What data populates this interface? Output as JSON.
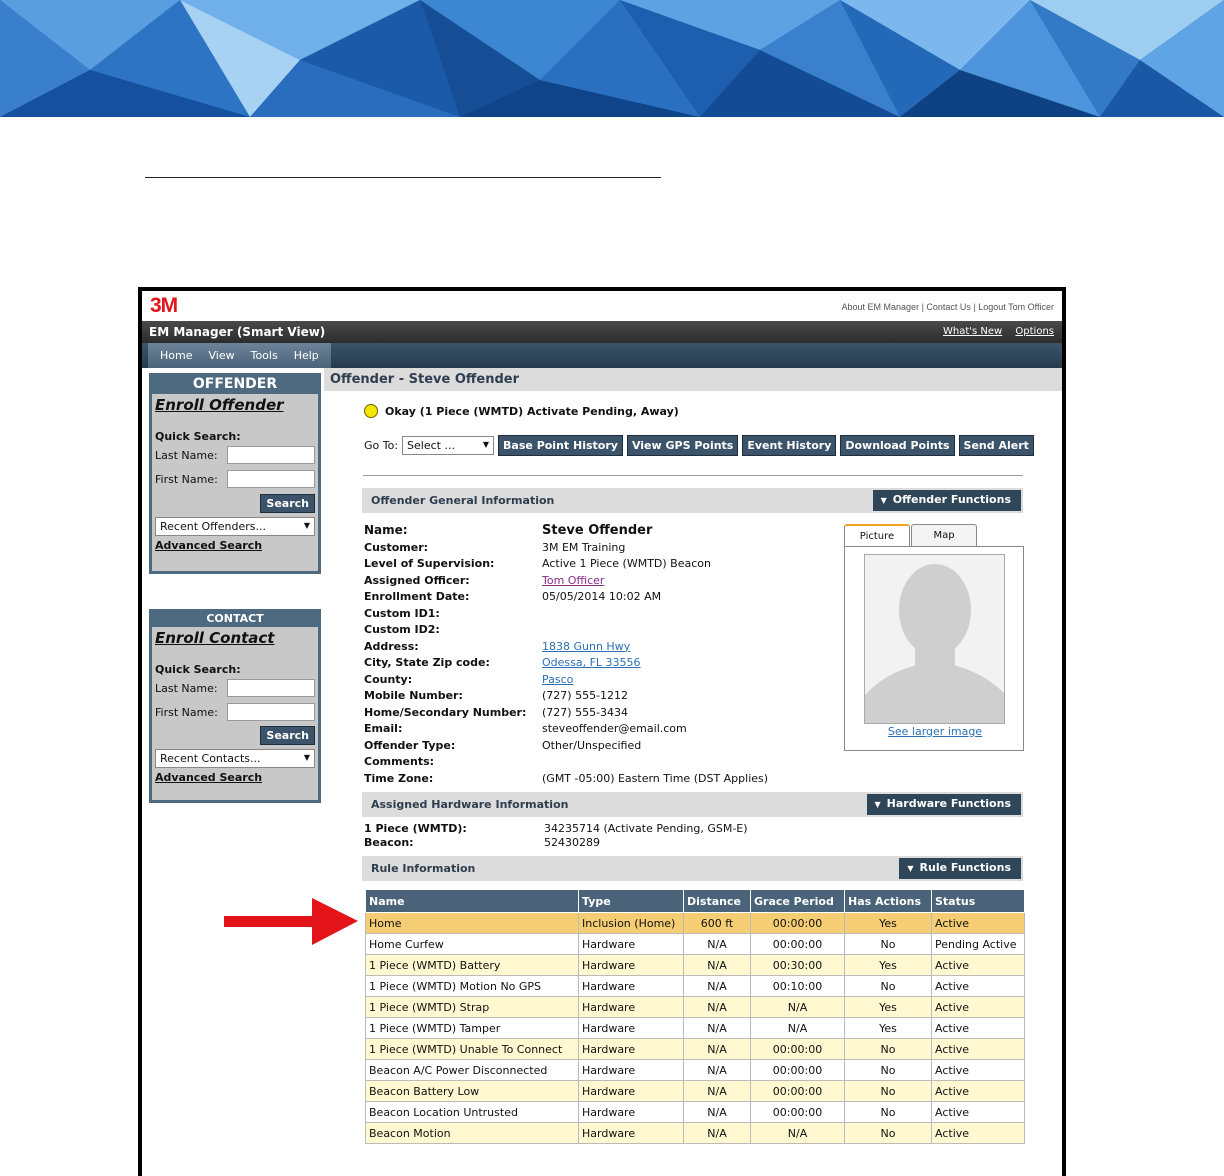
{
  "colors": {
    "accent": "#4e6a80",
    "logo": "#e0161b",
    "highlight": "#f5cd72",
    "arrow": "#e3151b"
  },
  "app": {
    "logo": "3M",
    "top_links": [
      "About EM Manager",
      "Contact Us",
      "Logout Tom Officer"
    ],
    "title": "EM Manager (Smart View)",
    "header_links": [
      "What's New",
      "Options"
    ],
    "menu": [
      "Home",
      "View",
      "Tools",
      "Help"
    ]
  },
  "sidebar": {
    "offender": {
      "heading": "OFFENDER",
      "enroll": "Enroll Offender",
      "quick_search": "Quick Search:",
      "last_name": "Last Name:",
      "first_name": "First Name:",
      "search_button": "Search",
      "recent": "Recent Offenders...",
      "advanced": "Advanced Search"
    },
    "contact": {
      "heading": "CONTACT",
      "enroll": "Enroll Contact",
      "quick_search": "Quick Search:",
      "last_name": "Last Name:",
      "first_name": "First Name:",
      "search_button": "Search",
      "recent": "Recent Contacts...",
      "advanced": "Advanced Search"
    }
  },
  "main": {
    "heading": "Offender - Steve Offender",
    "status": "Okay (1 Piece (WMTD) Activate Pending, Away)",
    "goto_label": "Go To:",
    "goto_select": "Select ...",
    "toolbar": [
      "Base Point History",
      "View GPS Points",
      "Event History",
      "Download Points",
      "Send Alert"
    ],
    "general": {
      "title": "Offender General Information",
      "button": "Offender Functions",
      "name_label": "Name:",
      "name_value": "Steve Offender",
      "rows": [
        {
          "label": "Customer:",
          "value": "3M EM Training"
        },
        {
          "label": "Level of Supervision:",
          "value": "Active 1 Piece (WMTD) Beacon"
        },
        {
          "label": "Assigned Officer:",
          "value": "Tom Officer"
        },
        {
          "label": "Enrollment Date:",
          "value": "05/05/2014 10:02 AM"
        },
        {
          "label": "Custom ID1:",
          "value": ""
        },
        {
          "label": "Custom ID2:",
          "value": ""
        },
        {
          "label": "Address:",
          "value": "1838 Gunn Hwy"
        },
        {
          "label": "City, State Zip code:",
          "value": "Odessa, FL 33556"
        },
        {
          "label": "County:",
          "value": "Pasco"
        },
        {
          "label": "Mobile Number:",
          "value": "(727) 555-1212"
        },
        {
          "label": "Home/Secondary Number:",
          "value": "(727) 555-3434"
        },
        {
          "label": "Email:",
          "value": "steveoffender@email.com"
        },
        {
          "label": "Offender Type:",
          "value": "Other/Unspecified"
        },
        {
          "label": "Comments:",
          "value": ""
        },
        {
          "label": "Time Zone:",
          "value": "(GMT -05:00) Eastern Time (DST Applies)"
        }
      ],
      "tabs": [
        "Picture",
        "Map"
      ],
      "larger_image": "See larger image"
    },
    "hardware": {
      "title": "Assigned Hardware Information",
      "button": "Hardware Functions",
      "rows": [
        {
          "label": "1 Piece (WMTD):",
          "value": "34235714 (Activate Pending, GSM-E)"
        },
        {
          "label": "Beacon:",
          "value": "52430289"
        }
      ]
    },
    "rules": {
      "title": "Rule Information",
      "button": "Rule Functions",
      "columns": [
        "Name",
        "Type",
        "Distance",
        "Grace Period",
        "Has Actions",
        "Status"
      ],
      "rows": [
        [
          "Home",
          "Inclusion (Home)",
          "600 ft",
          "00:00:00",
          "Yes",
          "Active"
        ],
        [
          "Home Curfew",
          "Hardware",
          "N/A",
          "00:00:00",
          "No",
          "Pending Active"
        ],
        [
          "1 Piece (WMTD) Battery",
          "Hardware",
          "N/A",
          "00:30:00",
          "Yes",
          "Active"
        ],
        [
          "1 Piece (WMTD) Motion No GPS",
          "Hardware",
          "N/A",
          "00:10:00",
          "No",
          "Active"
        ],
        [
          "1 Piece (WMTD) Strap",
          "Hardware",
          "N/A",
          "N/A",
          "Yes",
          "Active"
        ],
        [
          "1 Piece (WMTD) Tamper",
          "Hardware",
          "N/A",
          "N/A",
          "Yes",
          "Active"
        ],
        [
          "1 Piece (WMTD) Unable To Connect",
          "Hardware",
          "N/A",
          "00:00:00",
          "No",
          "Active"
        ],
        [
          "Beacon A/C Power Disconnected",
          "Hardware",
          "N/A",
          "00:00:00",
          "No",
          "Active"
        ],
        [
          "Beacon Battery Low",
          "Hardware",
          "N/A",
          "00:00:00",
          "No",
          "Active"
        ],
        [
          "Beacon Location Untrusted",
          "Hardware",
          "N/A",
          "00:00:00",
          "No",
          "Active"
        ],
        [
          "Beacon Motion",
          "Hardware",
          "N/A",
          "N/A",
          "No",
          "Active"
        ]
      ]
    }
  }
}
